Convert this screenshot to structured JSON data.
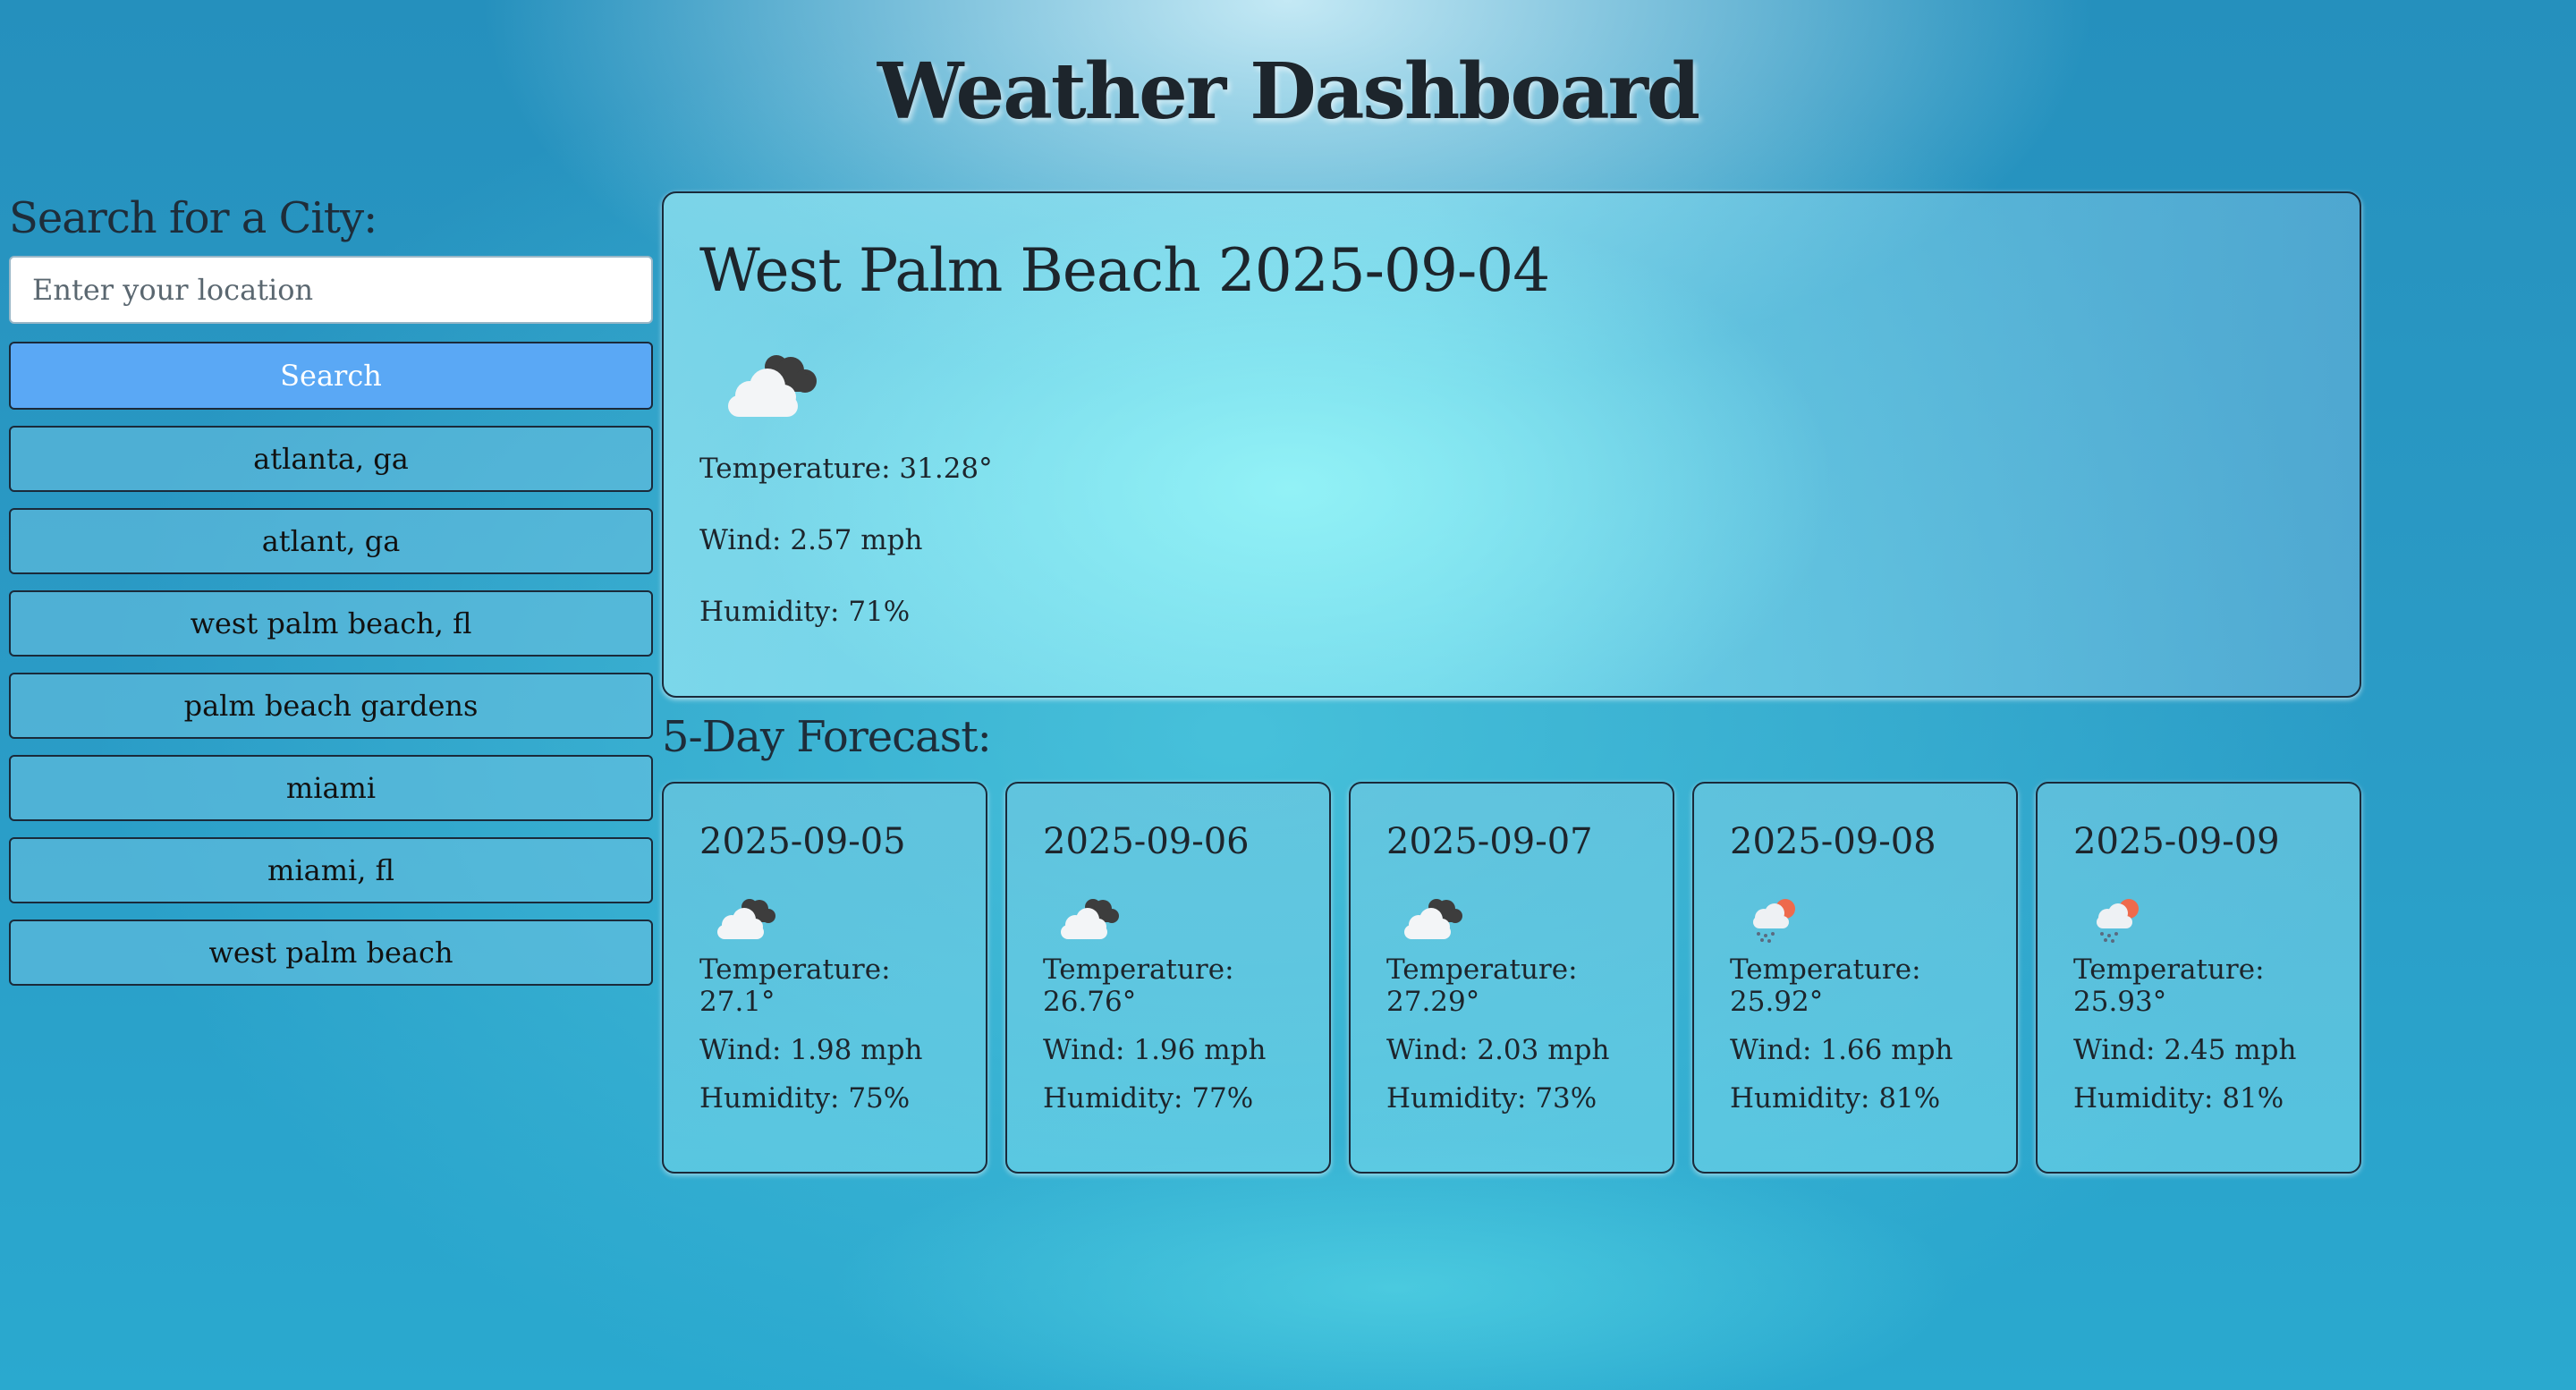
{
  "header": {
    "title": "Weather Dashboard"
  },
  "search": {
    "heading": "Search for a City:",
    "placeholder": "Enter your location",
    "value": "",
    "button_label": "Search"
  },
  "history": [
    {
      "label": "atlanta, ga"
    },
    {
      "label": "atlant, ga"
    },
    {
      "label": "west palm beach, fl"
    },
    {
      "label": "palm beach gardens"
    },
    {
      "label": "miami"
    },
    {
      "label": "miami, fl"
    },
    {
      "label": "west palm beach"
    }
  ],
  "current": {
    "title": "West Palm Beach 2025-09-04",
    "icon": "overcast-clouds-icon",
    "temperature": "Temperature: 31.28°",
    "wind": "Wind: 2.57 mph",
    "humidity": "Humidity: 71%"
  },
  "forecast": {
    "heading": "5-Day Forecast:",
    "days": [
      {
        "date": "2025-09-05",
        "icon": "overcast-clouds-icon",
        "temperature": "Temperature: 27.1°",
        "wind": "Wind: 1.98 mph",
        "humidity": "Humidity: 75%"
      },
      {
        "date": "2025-09-06",
        "icon": "overcast-clouds-icon",
        "temperature": "Temperature: 26.76°",
        "wind": "Wind: 1.96 mph",
        "humidity": "Humidity: 77%"
      },
      {
        "date": "2025-09-07",
        "icon": "overcast-clouds-icon",
        "temperature": "Temperature: 27.29°",
        "wind": "Wind: 2.03 mph",
        "humidity": "Humidity: 73%"
      },
      {
        "date": "2025-09-08",
        "icon": "rain-sun-icon",
        "temperature": "Temperature: 25.92°",
        "wind": "Wind: 1.66 mph",
        "humidity": "Humidity: 81%"
      },
      {
        "date": "2025-09-09",
        "icon": "rain-sun-icon",
        "temperature": "Temperature: 25.93°",
        "wind": "Wind: 2.45 mph",
        "humidity": "Humidity: 81%"
      }
    ]
  }
}
